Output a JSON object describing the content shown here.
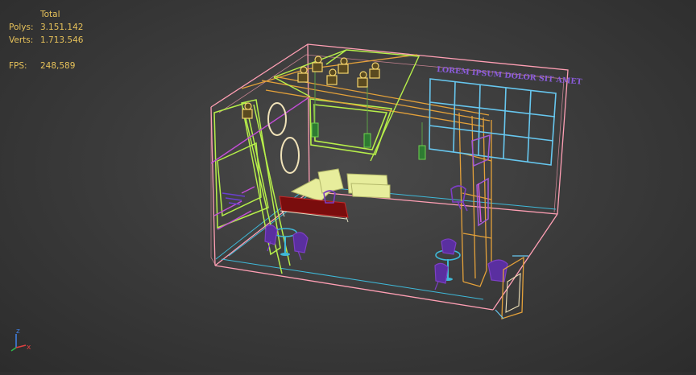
{
  "stats": {
    "header": "Total",
    "polys_label": "Polys:",
    "polys_value": "3.151.142",
    "verts_label": "Verts:",
    "verts_value": "1.713.546",
    "fps_label": "FPS:",
    "fps_value": "248,589"
  },
  "scene": {
    "banner_text": "LOREM IPSUM DOLOR SIT AMET"
  },
  "gizmo": {
    "z_label": "z",
    "x_label": "x"
  },
  "colors": {
    "background": "#3a3a3a",
    "stats_text": "#e7c25a",
    "room_outline": "#ff9fb4",
    "wall_panel": "#b7ef4a",
    "truss": "#e4a13a",
    "screen": "#67c7ef",
    "furniture": "#7d3fc5",
    "sofa": "#e7ed9c",
    "table_top": "#7a0d0d"
  }
}
